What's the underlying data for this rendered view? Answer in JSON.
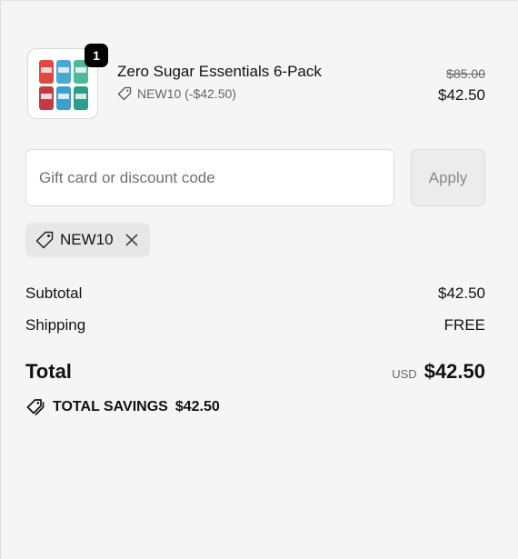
{
  "line_item": {
    "quantity": "1",
    "name": "Zero Sugar Essentials 6-Pack",
    "discount_label": "NEW10 (-$42.50)",
    "compare_price": "$85.00",
    "final_price": "$42.50",
    "image_icon": "product-cans-icon"
  },
  "discount_form": {
    "placeholder": "Gift card or discount code",
    "apply_label": "Apply"
  },
  "applied_code": {
    "code": "NEW10",
    "tag_icon": "tag-icon",
    "remove_icon": "close-icon"
  },
  "summary": {
    "subtotal_label": "Subtotal",
    "subtotal_value": "$42.50",
    "shipping_label": "Shipping",
    "shipping_value": "FREE",
    "total_label": "Total",
    "currency": "USD",
    "total_value": "$42.50",
    "savings_label": "TOTAL SAVINGS",
    "savings_value": "$42.50",
    "savings_icon": "tags-icon"
  },
  "colors": {
    "background": "#f5f5f5",
    "badge": "#000000",
    "apply_button_bg": "#ececec",
    "chip_bg": "#e7e7e7"
  }
}
